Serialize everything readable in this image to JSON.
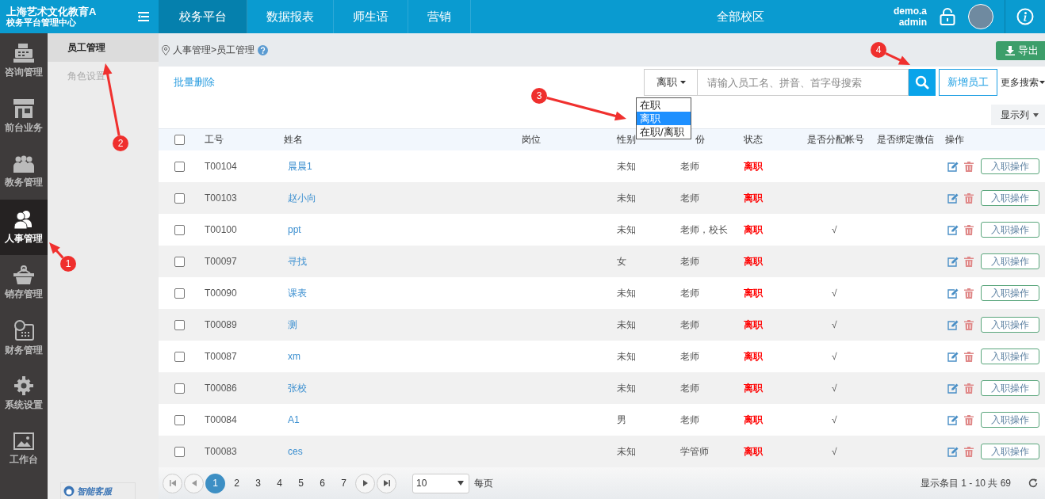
{
  "brand": {
    "title": "上海艺术文化教育A",
    "subtitle": "校务平台管理中心"
  },
  "nav_tabs": [
    {
      "label": "校务平台",
      "selected": true
    },
    {
      "label": "数据报表",
      "selected": false
    },
    {
      "label": "师生语",
      "selected": false
    },
    {
      "label": "营销",
      "selected": false
    }
  ],
  "campus": "全部校区",
  "user": {
    "name": "demo.a",
    "role": "admin"
  },
  "sidebar": {
    "items": [
      {
        "label": "咨询管理",
        "kind": "register",
        "selected": false
      },
      {
        "label": "前台业务",
        "kind": "store",
        "selected": false
      },
      {
        "label": "教务管理",
        "kind": "group",
        "selected": false
      },
      {
        "label": "人事管理",
        "kind": "people",
        "selected": true
      },
      {
        "label": "销存管理",
        "kind": "basket",
        "selected": false
      },
      {
        "label": "财务管理",
        "kind": "calendar",
        "selected": false
      },
      {
        "label": "系统设置",
        "kind": "gear",
        "selected": false
      },
      {
        "label": "工作台",
        "kind": "picture",
        "selected": false
      }
    ]
  },
  "submenu": {
    "items": [
      {
        "label": "员工管理",
        "selected": true
      },
      {
        "label": "角色设置",
        "selected": false
      }
    ],
    "service_logo": "智能客服"
  },
  "breadcrumb": "人事管理>员工管理",
  "export_button": "导出",
  "toolbar": {
    "bulk_delete": "批量删除",
    "status_select": "离职",
    "search": {
      "placeholder": "请输入员工名、拼音、首字母搜索"
    },
    "add_button": "新增员工",
    "more_search": "更多搜索",
    "columns_button": "显示列"
  },
  "status_options": [
    {
      "label": "在职",
      "selected": false
    },
    {
      "label": "离职",
      "selected": true
    },
    {
      "label": "在职/离职",
      "selected": false
    }
  ],
  "table": {
    "select_all_checked": false,
    "columns": [
      "工号",
      "姓名",
      "岗位",
      "性别",
      "份",
      "状态",
      "是否分配帐号",
      "是否绑定微信",
      "操作"
    ],
    "rows": [
      {
        "employee_no": "T00104",
        "name": "晨晨1",
        "gender": "未知",
        "identity": "老师",
        "status": "离职",
        "checked": false,
        "action": "入职操作"
      },
      {
        "employee_no": "T00103",
        "name": "赵小向",
        "gender": "未知",
        "identity": "老师",
        "status": "离职",
        "checked": false,
        "action": "入职操作"
      },
      {
        "employee_no": "T00100",
        "name": "ppt",
        "gender": "未知",
        "identity": "老师，校长",
        "status": "离职",
        "account": "√",
        "checked": false,
        "action": "入职操作"
      },
      {
        "employee_no": "T00097",
        "name": "寻找",
        "gender": "女",
        "identity": "老师",
        "status": "离职",
        "checked": false,
        "action": "入职操作"
      },
      {
        "employee_no": "T00090",
        "name": "课表",
        "gender": "未知",
        "identity": "老师",
        "status": "离职",
        "account": "√",
        "checked": false,
        "action": "入职操作"
      },
      {
        "employee_no": "T00089",
        "name": "测",
        "gender": "未知",
        "identity": "老师",
        "status": "离职",
        "account": "√",
        "checked": false,
        "action": "入职操作"
      },
      {
        "employee_no": "T00087",
        "name": "xm",
        "gender": "未知",
        "identity": "老师",
        "status": "离职",
        "account": "√",
        "checked": false,
        "action": "入职操作"
      },
      {
        "employee_no": "T00086",
        "name": "张校",
        "gender": "未知",
        "identity": "老师",
        "status": "离职",
        "account": "√",
        "checked": false,
        "action": "入职操作"
      },
      {
        "employee_no": "T00084",
        "name": "A1",
        "gender": "男",
        "identity": "老师",
        "status": "离职",
        "account": "√",
        "checked": false,
        "action": "入职操作"
      },
      {
        "employee_no": "T00083",
        "name": "ces",
        "gender": "未知",
        "identity": "学管师",
        "status": "离职",
        "account": "√",
        "checked": false,
        "action": "入职操作"
      }
    ]
  },
  "pagination": {
    "pages": [
      {
        "label": "1",
        "selected": true
      },
      {
        "label": "2",
        "selected": false
      },
      {
        "label": "3",
        "selected": false
      },
      {
        "label": "4",
        "selected": false
      },
      {
        "label": "5",
        "selected": false
      },
      {
        "label": "6",
        "selected": false
      },
      {
        "label": "7",
        "selected": false
      }
    ],
    "rows_per_page": "10",
    "rows_per_page_label": "每页",
    "summary": "显示条目 1 - 10 共 69"
  },
  "annotations": [
    {
      "label": "1"
    },
    {
      "label": "2"
    },
    {
      "label": "3"
    },
    {
      "label": "4"
    }
  ]
}
